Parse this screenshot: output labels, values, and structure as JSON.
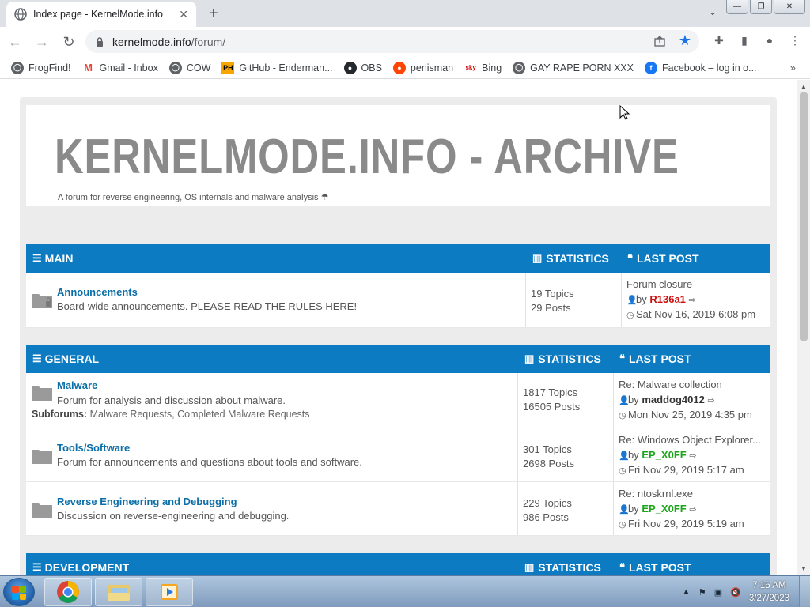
{
  "browser": {
    "tab_title": "Index page - KernelMode.info",
    "url_host": "kernelmode.info",
    "url_path": "/forum/",
    "bookmarks": [
      {
        "label": "FrogFind!",
        "icon": "globe-icon",
        "color": "#5f6368"
      },
      {
        "label": "Gmail - Inbox",
        "icon": "gmail-icon",
        "color": "#ea4335"
      },
      {
        "label": "COW",
        "icon": "globe-icon",
        "color": "#5f6368"
      },
      {
        "label": "GitHub - Enderman...",
        "icon": "ph-icon",
        "color": "#f7a600"
      },
      {
        "label": "OBS",
        "icon": "github-icon",
        "color": "#24292e"
      },
      {
        "label": "penisman",
        "icon": "reddit-icon",
        "color": "#ff4500"
      },
      {
        "label": "Bing",
        "icon": "sky-icon",
        "color": "#d40000"
      },
      {
        "label": "GAY RAPE PORN XXX",
        "icon": "globe-icon",
        "color": "#5f6368"
      },
      {
        "label": "Facebook – log in o...",
        "icon": "facebook-icon",
        "color": "#1877f2"
      }
    ]
  },
  "site": {
    "title": "KERNELMODE.INFO - ARCHIVE",
    "description": "A forum for reverse engineering, OS internals and malware analysis"
  },
  "headers": {
    "statistics": "STATISTICS",
    "last_post": "LAST POST",
    "by": "by"
  },
  "categories": {
    "main": {
      "name": "MAIN",
      "forums": [
        {
          "title": "Announcements",
          "desc": "Board-wide announcements. PLEASE READ THE RULES HERE!",
          "topics": "19 Topics",
          "posts": "29 Posts",
          "last_title": "Forum closure",
          "last_user": "R136a1",
          "last_time": "Sat Nov 16, 2019 6:08 pm"
        }
      ]
    },
    "general": {
      "name": "GENERAL",
      "forums": [
        {
          "title": "Malware",
          "desc": "Forum for analysis and discussion about malware.",
          "subforums_label": "Subforums:",
          "subforums": "Malware Requests, Completed Malware Requests",
          "topics": "1817 Topics",
          "posts": "16505 Posts",
          "last_title": "Re: Malware collection",
          "last_user": "maddog4012",
          "last_time": "Mon Nov 25, 2019 4:35 pm"
        },
        {
          "title": "Tools/Software",
          "desc": "Forum for announcements and questions about tools and software.",
          "topics": "301 Topics",
          "posts": "2698 Posts",
          "last_title": "Re: Windows Object Explorer...",
          "last_user": "EP_X0FF",
          "last_time": "Fri Nov 29, 2019 5:17 am"
        },
        {
          "title": "Reverse Engineering and Debugging",
          "desc": "Discussion on reverse-engineering and debugging.",
          "topics": "229 Topics",
          "posts": "986 Posts",
          "last_title": "Re: ntoskrnl.exe",
          "last_user": "EP_X0FF",
          "last_time": "Fri Nov 29, 2019 5:19 am"
        }
      ]
    },
    "development": {
      "name": "DEVELOPMENT"
    }
  },
  "taskbar": {
    "time": "7:16 AM",
    "date": "3/27/2023"
  },
  "colors": {
    "forum_header": "#0c7bc1",
    "forum_link": "#0c6ea8",
    "user_admin": "#cc1010",
    "user_mod": "#1aa51a"
  }
}
